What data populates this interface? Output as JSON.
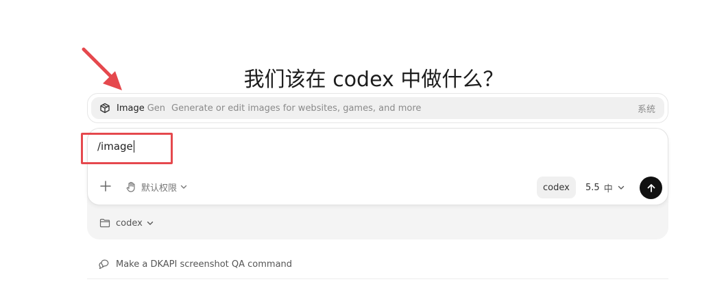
{
  "heading": "我们该在 codex 中做什么？",
  "suggestion": {
    "name": "Image",
    "name_suffix": "Gen",
    "description": "Generate or edit images for websites, games, and more",
    "tag": "系统",
    "icon": "cube-icon"
  },
  "composer": {
    "value": "/image",
    "permission_label": "默认权限",
    "workspace_chip": "codex",
    "model_label": "5.5",
    "effort_label": "中",
    "plus_icon": "plus-icon",
    "send_icon": "arrow-up-icon"
  },
  "project": {
    "folder_label": "codex"
  },
  "bottom_suggestion": {
    "label": "Make a DKAPI screenshot QA command"
  },
  "colors": {
    "annotation": "#e5484d",
    "send_button": "#111111",
    "suggestion_bg": "#f0f0f0",
    "composer_back": "#f4f4f4"
  }
}
